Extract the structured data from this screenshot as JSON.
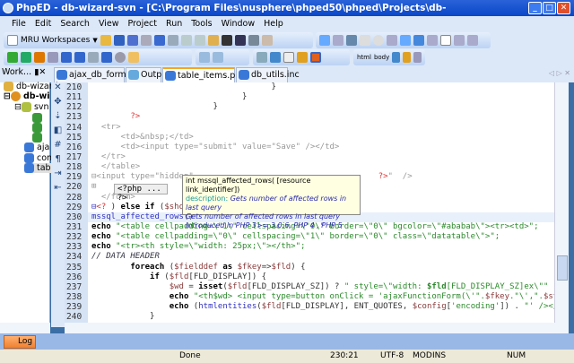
{
  "window": {
    "title": "PhpED - db-wizard-svn - [C:\\Program Files\\nusphere\\phped50\\phped\\Projects\\db-wizard\\table_items.php]"
  },
  "menu": [
    "File",
    "Edit",
    "Search",
    "View",
    "Project",
    "Run",
    "Tools",
    "Window",
    "Help"
  ],
  "toolbar": {
    "mru": "MRU Workspaces",
    "html_label": "html",
    "body_label": "body"
  },
  "tabs": [
    {
      "label": "ajax_db_form.php"
    },
    {
      "label": "Output"
    },
    {
      "label": "table_items.php *"
    },
    {
      "label": "db_utils.inc"
    }
  ],
  "workspace": {
    "title": "Work...",
    "items": [
      "db-wizard",
      "db-wi",
      "svn",
      "aja",
      "con",
      "tab"
    ]
  },
  "editor": {
    "lines": [
      "210",
      "211",
      "212",
      "213",
      "214",
      "215",
      "216",
      "217",
      "218",
      "219",
      "220",
      "228",
      "229",
      "230",
      "231",
      "232",
      "233",
      "234",
      "235",
      "236",
      "237",
      "238",
      "239",
      "240"
    ],
    "fold_label": "<?php ... ?>"
  },
  "tooltip": {
    "signature": "int mssql_affected_rows( [resource link_identifier])",
    "desc_label": "description:",
    "desc": "Gets number of affected rows in last query",
    "desc2": "Gets number of affected rows in last query",
    "intro": "Introduced in PHP 3>= 3.0.6, PHP 4 , PHP 5"
  },
  "log": {
    "label": "Log"
  },
  "status": {
    "state": "Done",
    "position": "230:21",
    "encoding": "UTF-8",
    "mod": "MOD",
    "ins": "INS",
    "num": "NUM"
  }
}
